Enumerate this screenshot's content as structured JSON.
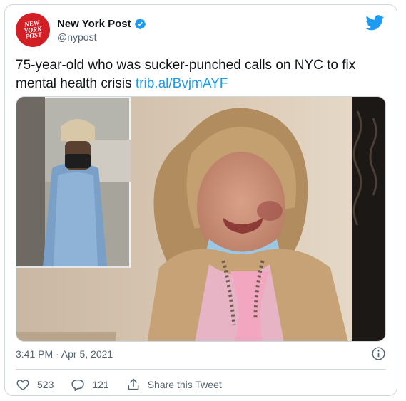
{
  "account": {
    "name": "New York Post",
    "handle": "@nypost",
    "logo_lines": [
      "NEW",
      "YORK",
      "POST"
    ]
  },
  "tweet": {
    "text": "75-year-old who was sucker-punched calls on NYC to fix mental health crisis",
    "link": "trib.al/BvjmAYF",
    "timestamp": "3:41 PM · Apr 5, 2021"
  },
  "actions": {
    "like_count": "523",
    "reply_count": "121",
    "share_label": "Share this Tweet"
  },
  "icons": {
    "platform": "twitter-bird-icon",
    "verified": "verified-badge-icon",
    "info": "info-icon",
    "like": "heart-icon",
    "reply": "reply-icon",
    "share": "share-icon"
  },
  "colors": {
    "accent": "#1d9bf0",
    "brand": "#d21f26",
    "muted": "#536471",
    "border": "#cfd9de"
  }
}
